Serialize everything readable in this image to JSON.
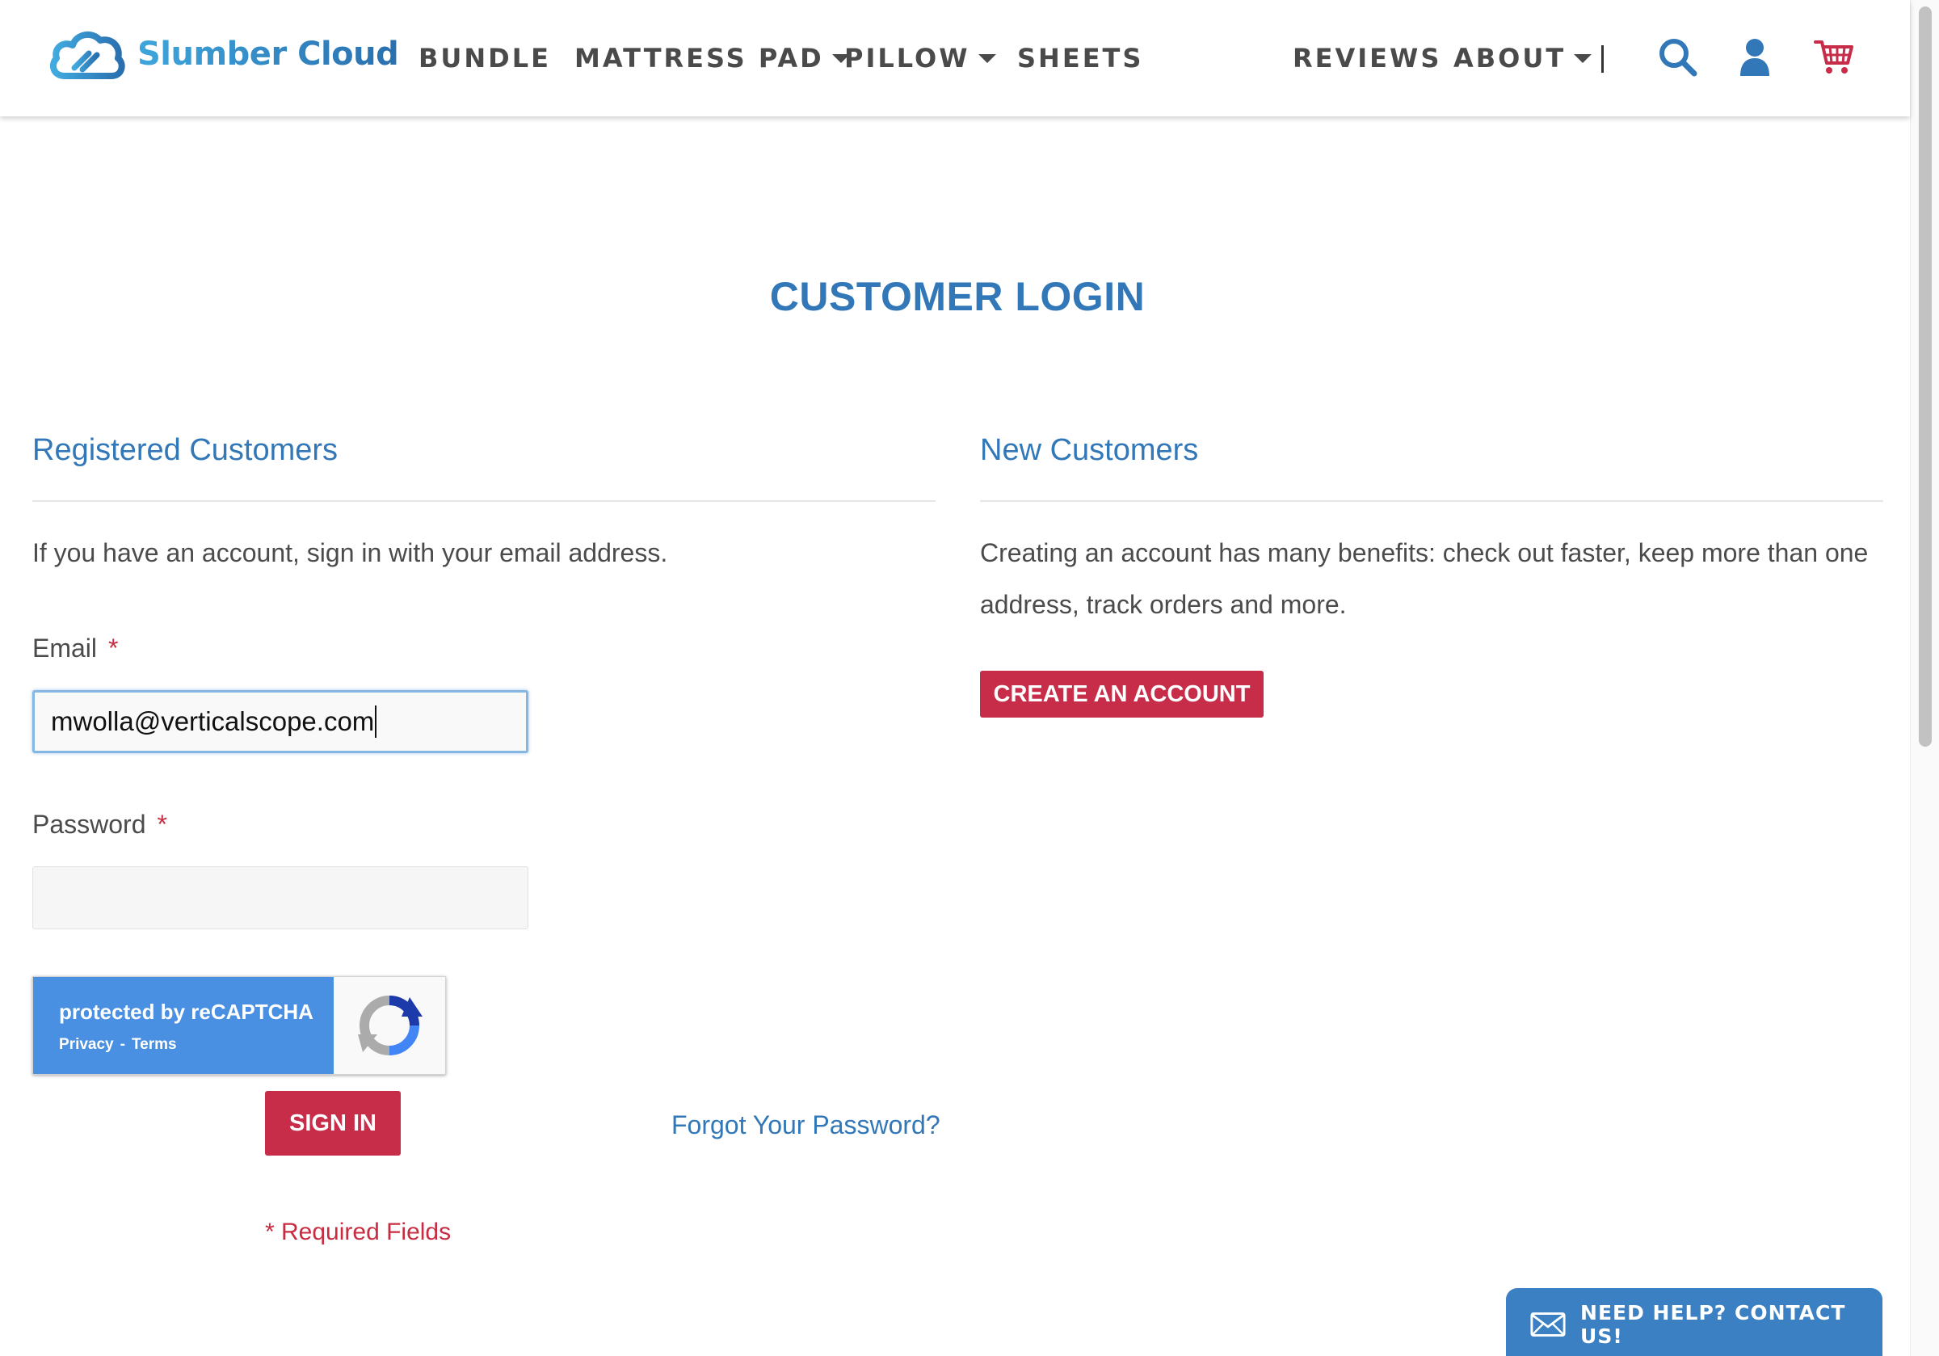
{
  "brand": {
    "name": "Slumber Cloud",
    "accent": "#3277b7",
    "button_color": "#c72c48"
  },
  "nav": {
    "bundle": "BUNDLE",
    "mattress_pad": "MATTRESS PAD",
    "pillow": "PILLOW",
    "sheets": "SHEETS",
    "reviews": "REVIEWS",
    "about": "ABOUT",
    "icons": [
      "search-icon",
      "user-icon",
      "cart-icon"
    ]
  },
  "page": {
    "title": "CUSTOMER LOGIN"
  },
  "registered": {
    "heading": "Registered Customers",
    "intro": "If you have an account, sign in with your email address.",
    "email_label": "Email",
    "email_value": "mwolla@verticalscope.com",
    "password_label": "Password",
    "password_value": "",
    "required_mark": "*",
    "signin_label": "SIGN IN",
    "forgot_label": "Forgot Your Password?",
    "required_note": "* Required Fields"
  },
  "recaptcha": {
    "main": "protected by reCAPTCHA",
    "privacy": "Privacy",
    "sep": "-",
    "terms": "Terms"
  },
  "new_customers": {
    "heading": "New Customers",
    "intro": "Creating an account has many benefits: check out faster, keep more than one address, track orders and more.",
    "create_label": "CREATE AN ACCOUNT"
  },
  "help": {
    "label": "NEED HELP? CONTACT US!"
  }
}
